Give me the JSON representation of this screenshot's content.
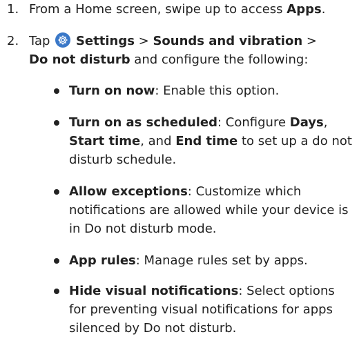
{
  "steps": [
    {
      "number": "1.",
      "prefix": "From a Home screen, swipe up to access ",
      "bold": "Apps",
      "suffix": "."
    },
    {
      "number": "2.",
      "prefix": "Tap",
      "icon": "settings-gear-icon",
      "settings": "Settings",
      "sep1": " > ",
      "sounds": "Sounds and vibration",
      "sep2": " >",
      "dnd": "Do not disturb",
      "suffix": " and configure the following:"
    }
  ],
  "bullets": [
    {
      "term": "Turn on now",
      "text": ": Enable this option."
    },
    {
      "term": "Turn on as scheduled",
      "text_a": ": Configure ",
      "days": "Days",
      "text_b": ",",
      "start": "Start time",
      "text_c": ", and ",
      "end": "End time",
      "text_d": " to set up a do not disturb schedule."
    },
    {
      "term": "Allow exceptions",
      "text": ": Customize which notifications are allowed while your device is in Do not disturb mode."
    },
    {
      "term": "App rules",
      "text": ": Manage rules set by apps."
    },
    {
      "term": "Hide visual notifications",
      "text": ": Select options for preventing visual notifications for apps silenced by Do not disturb."
    }
  ],
  "colors": {
    "text": "#222222",
    "icon_bg": "#3a78c8"
  }
}
